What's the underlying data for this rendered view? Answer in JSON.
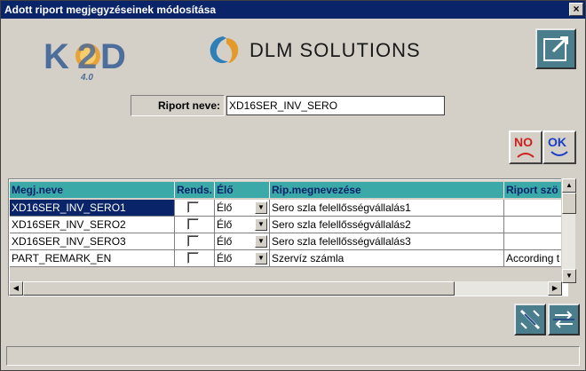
{
  "window": {
    "title": "Adott riport megjegyzéseinek módosítása",
    "close_label": "×"
  },
  "logos": {
    "k2d_version": "4.0",
    "dlm_text": "DLM SOLUTIONS"
  },
  "form": {
    "report_name_label": "Riport neve:",
    "report_name_value": "XD16SER_INV_SERO"
  },
  "buttons": {
    "no_label": "NO",
    "ok_label": "OK"
  },
  "grid": {
    "columns": [
      "Megj.neve",
      "Rends.",
      "Élő",
      "Rip.megnevezése",
      "Riport szö"
    ],
    "rows": [
      {
        "name": "XD16SER_INV_SERO1",
        "checked": false,
        "status": "Élő",
        "title": "Sero szla felellősségvállalás1",
        "report_text": "",
        "selected": true
      },
      {
        "name": "XD16SER_INV_SERO2",
        "checked": false,
        "status": "Élő",
        "title": "Sero szla felellősségvállalás2",
        "report_text": "",
        "selected": false
      },
      {
        "name": "XD16SER_INV_SERO3",
        "checked": false,
        "status": "Élő",
        "title": "Sero szla felellősségvállalás3",
        "report_text": "",
        "selected": false
      },
      {
        "name": "PART_REMARK_EN",
        "checked": false,
        "status": "Élő",
        "title": "Szervíz számla",
        "report_text": "According t",
        "selected": false
      }
    ]
  },
  "status_text": ""
}
